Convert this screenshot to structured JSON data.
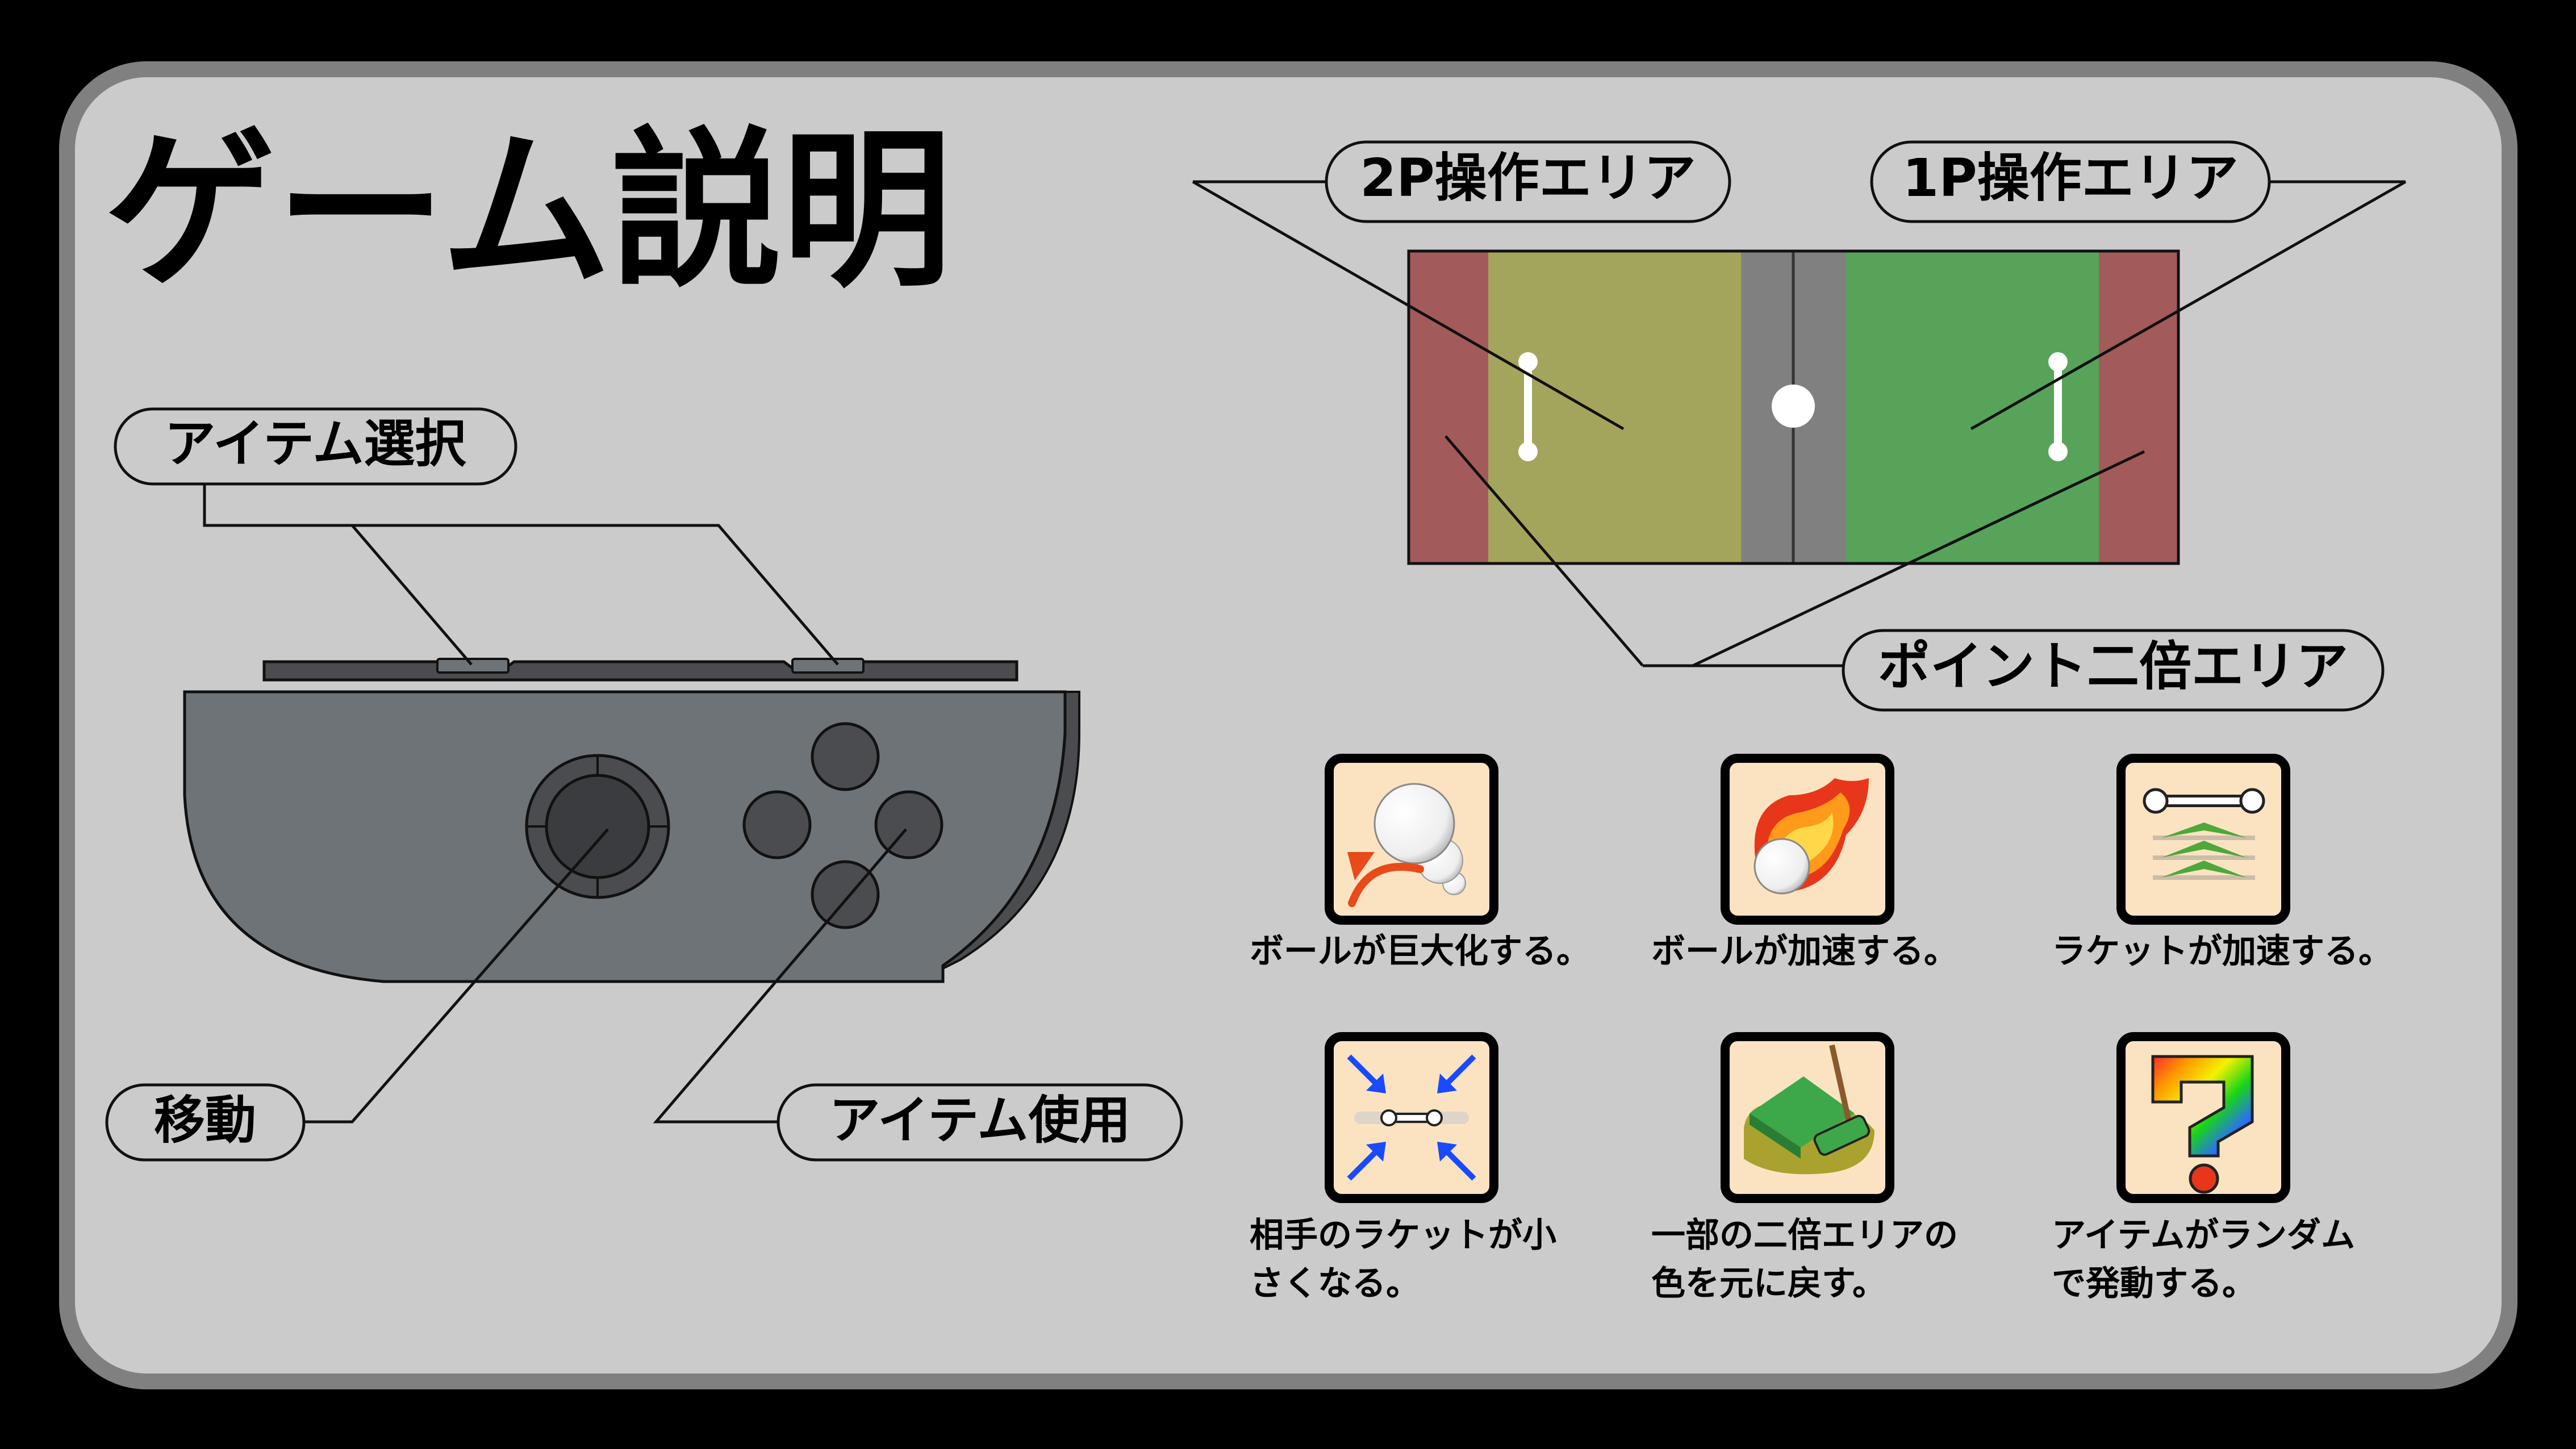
{
  "title": "ゲーム説明",
  "field": {
    "area_2p_label": "2P操作エリア",
    "area_1p_label": "1P操作エリア",
    "double_point_label": "ポイント二倍エリア"
  },
  "controller": {
    "item_select_label": "アイテム選択",
    "move_label": "移動",
    "item_use_label": "アイテム使用"
  },
  "items": [
    {
      "icon": "ball-grow-icon",
      "line1": "ボールが巨大化する。",
      "line2": ""
    },
    {
      "icon": "fire-ball-icon",
      "line1": "ボールが加速する。",
      "line2": ""
    },
    {
      "icon": "racket-speed-icon",
      "line1": "ラケットが加速する。",
      "line2": ""
    },
    {
      "icon": "racket-shrink-icon",
      "line1": "相手のラケットが小",
      "line2": "さくなる。"
    },
    {
      "icon": "paint-roller-icon",
      "line1": "一部の二倍エリアの",
      "line2": "色を元に戻す。"
    },
    {
      "icon": "random-question-icon",
      "line1": "アイテムがランダム",
      "line2": "で発動する。"
    }
  ],
  "colors": {
    "background": "#000000",
    "panel": "#cbcbcb",
    "frame_gray": "#808080",
    "neon_yellow": "#f2f000",
    "neon_green": "#33ff00",
    "field_red": "#a35a5a",
    "field_olive": "#a4a55c",
    "field_green": "#57a35a",
    "field_center": "#808080",
    "controller_body": "#6e7377",
    "controller_dark": "#4a4c4f",
    "icon_bg": "#fbe3c2"
  }
}
